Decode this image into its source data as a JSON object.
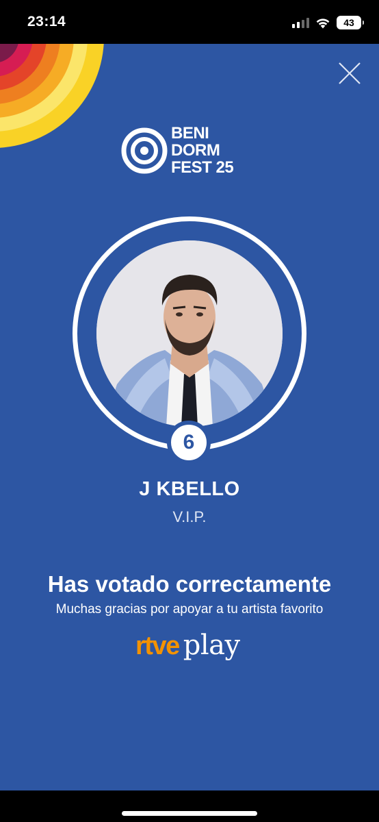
{
  "status_bar": {
    "time": "23:14",
    "battery": "43",
    "icons": [
      "signal-icon",
      "wifi-icon",
      "battery-icon"
    ]
  },
  "modal": {
    "close_icon": "close-icon",
    "logo": {
      "line1": "BENI",
      "line2": "DORM",
      "line3": "FEST 25"
    },
    "contestant": {
      "number": "6",
      "artist": "J KBELLO",
      "song": "V.I.P."
    },
    "message": {
      "title": "Has votado correctamente",
      "subtitle": "Muchas gracias por apoyar a tu artista favorito"
    },
    "brand": {
      "rtve": "rtve",
      "play": "play"
    }
  },
  "colors": {
    "background": "#2d56a3",
    "accent_orange": "#f39200",
    "text": "#ffffff"
  }
}
